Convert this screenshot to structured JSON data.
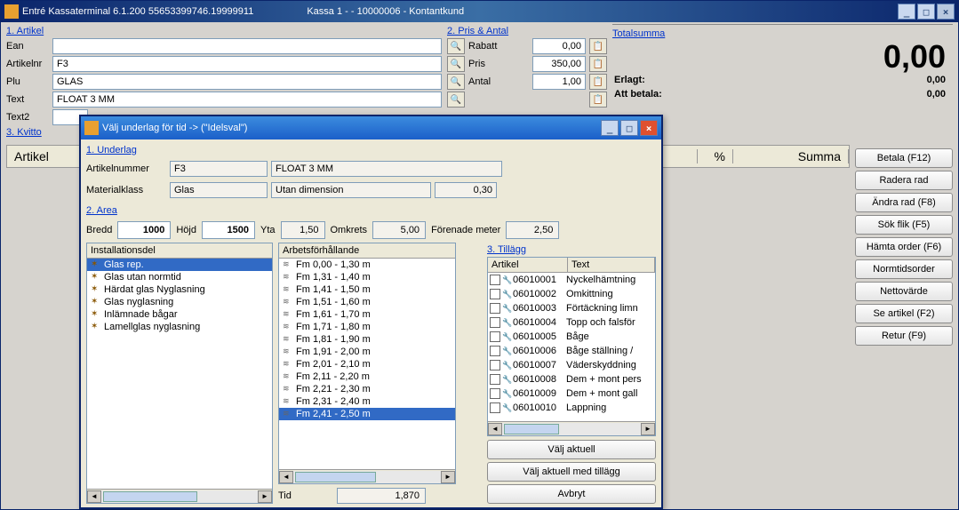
{
  "main_title_left": "Entré Kassaterminal 6.1.200  55653399746.19999911",
  "main_title_right": "Kassa 1 -  - 10000006 - Kontantkund",
  "section_artikel": "1. Artikel",
  "section_pris": "2. Pris & Antal",
  "section_kvitto": "3. Kvitto",
  "section_total": "Totalsumma",
  "labels": {
    "ean": "Ean",
    "artikelnr": "Artikelnr",
    "plu": "Plu",
    "text": "Text",
    "text2": "Text2",
    "rabatt": "Rabatt",
    "pris": "Pris",
    "antal": "Antal",
    "erlagt": "Erlagt:",
    "att_betala": "Att betala:"
  },
  "values": {
    "ean": "",
    "artikelnr": "F3",
    "plu": "GLAS",
    "text": "FLOAT 3 MM",
    "text2": "",
    "rabatt": "0,00",
    "pris": "350,00",
    "antal": "1,00",
    "total_big": "0,00",
    "erlagt": "0,00",
    "att_betala": "0,00"
  },
  "grid_headers": {
    "artikel": "Artikel",
    "pct": "%",
    "summa": "Summa"
  },
  "side_buttons": [
    "Betala (F12)",
    "Radera rad",
    "Ändra rad (F8)",
    "Sök flik (F5)",
    "Hämta order (F6)",
    "Normtidsorder",
    "Nettovärde",
    "Se artikel (F2)",
    "Retur (F9)"
  ],
  "modal": {
    "title": "Välj underlag för tid   -> (\"Idelsval\")",
    "section_underlag": "1. Underlag",
    "section_area": "2. Area",
    "section_tillagg": "3. Tillägg",
    "underlag": {
      "artikelnr_lbl": "Artikelnummer",
      "materialklass_lbl": "Materialklass",
      "artikelnr": "F3",
      "artikelnr_text": "FLOAT 3 MM",
      "materialklass": "Glas",
      "dimension": "Utan dimension",
      "dim_val": "0,30"
    },
    "area": {
      "bredd_lbl": "Bredd",
      "bredd": "1000",
      "hojd_lbl": "Höjd",
      "hojd": "1500",
      "yta_lbl": "Yta",
      "yta": "1,50",
      "omkrets_lbl": "Omkrets",
      "omkrets": "5,00",
      "fm_lbl": "Förenade meter",
      "fm": "2,50"
    },
    "inst_header": "Installationsdel",
    "inst_items": [
      "Glas rep.",
      "Glas utan normtid",
      "Härdat glas Nyglasning",
      "Glas nyglasning",
      "Inlämnade bågar",
      "Lamellglas nyglasning"
    ],
    "arb_header": "Arbetsförhållande",
    "arb_items": [
      "Fm 0,00 - 1,30 m",
      "Fm 1,31 - 1,40 m",
      "Fm 1,41 - 1,50 m",
      "Fm 1,51 - 1,60 m",
      "Fm 1,61 - 1,70 m",
      "Fm 1,71 - 1,80 m",
      "Fm 1,81 - 1,90 m",
      "Fm 1,91 - 2,00 m",
      "Fm 2,01 - 2,10 m",
      "Fm 2,11 - 2,20 m",
      "Fm 2,21 - 2,30 m",
      "Fm 2,31 - 2,40 m",
      "Fm 2,41 - 2,50 m"
    ],
    "tillagg_cols": {
      "artikel": "Artikel",
      "text": "Text"
    },
    "tillagg_rows": [
      {
        "art": "06010001",
        "txt": "Nyckelhämtning"
      },
      {
        "art": "06010002",
        "txt": "Omkittning"
      },
      {
        "art": "06010003",
        "txt": "Förtäckning limn"
      },
      {
        "art": "06010004",
        "txt": "Topp och falsför"
      },
      {
        "art": "06010005",
        "txt": "Båge"
      },
      {
        "art": "06010006",
        "txt": "Båge ställning /"
      },
      {
        "art": "06010007",
        "txt": "Väderskyddning"
      },
      {
        "art": "06010008",
        "txt": "Dem + mont pers"
      },
      {
        "art": "06010009",
        "txt": "Dem + mont gall"
      },
      {
        "art": "06010010",
        "txt": "Lappning"
      }
    ],
    "tid_lbl": "Tid",
    "tid_val": "1,870",
    "btn_valj": "Välj aktuell",
    "btn_valj_tillagg": "Välj aktuell med tillägg",
    "btn_avbryt": "Avbryt"
  }
}
